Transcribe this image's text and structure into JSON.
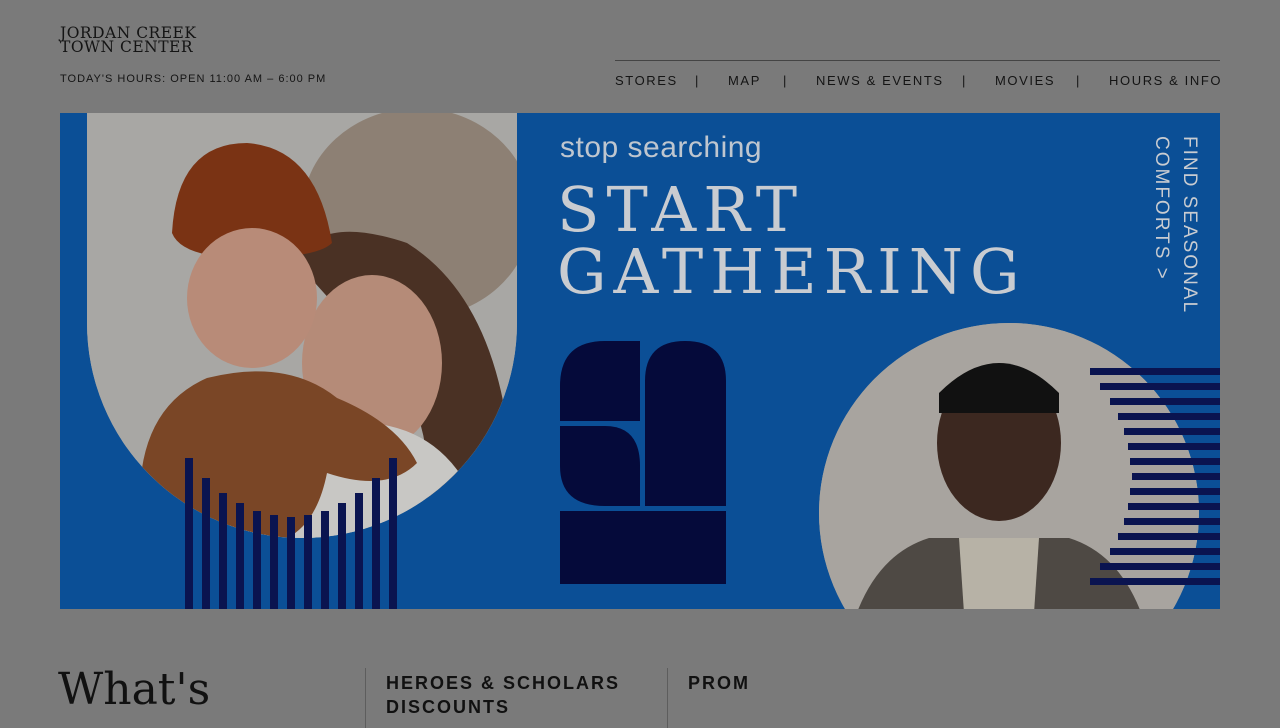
{
  "header": {
    "logo_line1": "JORDAN CREEK",
    "logo_line2": "TOWN CENTER",
    "hours": "TODAY'S HOURS: OPEN 11:00 AM – 6:00 PM",
    "nav": [
      {
        "label": "STORES"
      },
      {
        "label": "MAP"
      },
      {
        "label": "NEWS & EVENTS"
      },
      {
        "label": "MOVIES"
      },
      {
        "label": "HOURS & INFO"
      }
    ],
    "separator": "|"
  },
  "hero": {
    "tagline": "stop searching",
    "headline_line1": "START",
    "headline_line2": "GATHERING",
    "cta_line1": "FIND SEASONAL",
    "cta_line2": "COMFORTS >",
    "colors": {
      "background": "#0b4f96",
      "navy": "#0a1450",
      "headline": "#c9ccd1"
    }
  },
  "whats_on": {
    "title": "What's",
    "cards": [
      {
        "title": "HEROES & SCHOLARS",
        "title_line2": "DISCOUNTS"
      },
      {
        "title": "PROM"
      }
    ]
  }
}
